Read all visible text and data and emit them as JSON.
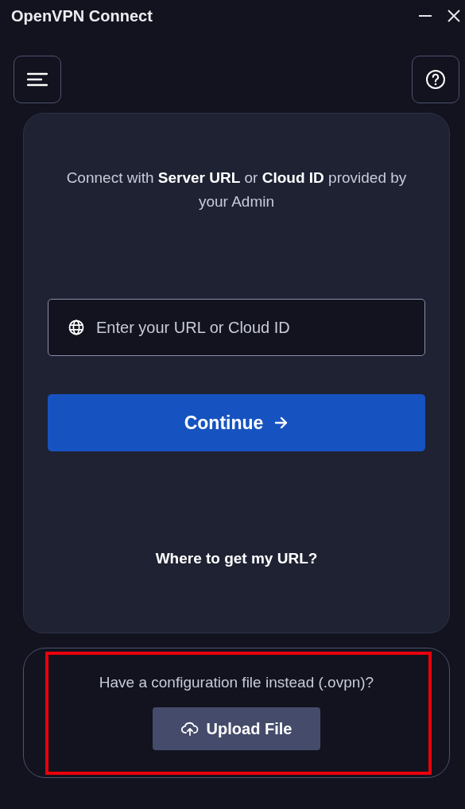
{
  "window": {
    "title": "OpenVPN Connect"
  },
  "prompt": "Connect with **Server URL** or **Cloud ID** provided by your Admin",
  "url_field": {
    "placeholder": "Enter your URL or Cloud ID"
  },
  "continue_button": "Continue",
  "help_link": "Where to get my URL?",
  "config_card": {
    "text": "Have a configuration file instead (.ovpn)?",
    "upload_button": "Upload File"
  }
}
